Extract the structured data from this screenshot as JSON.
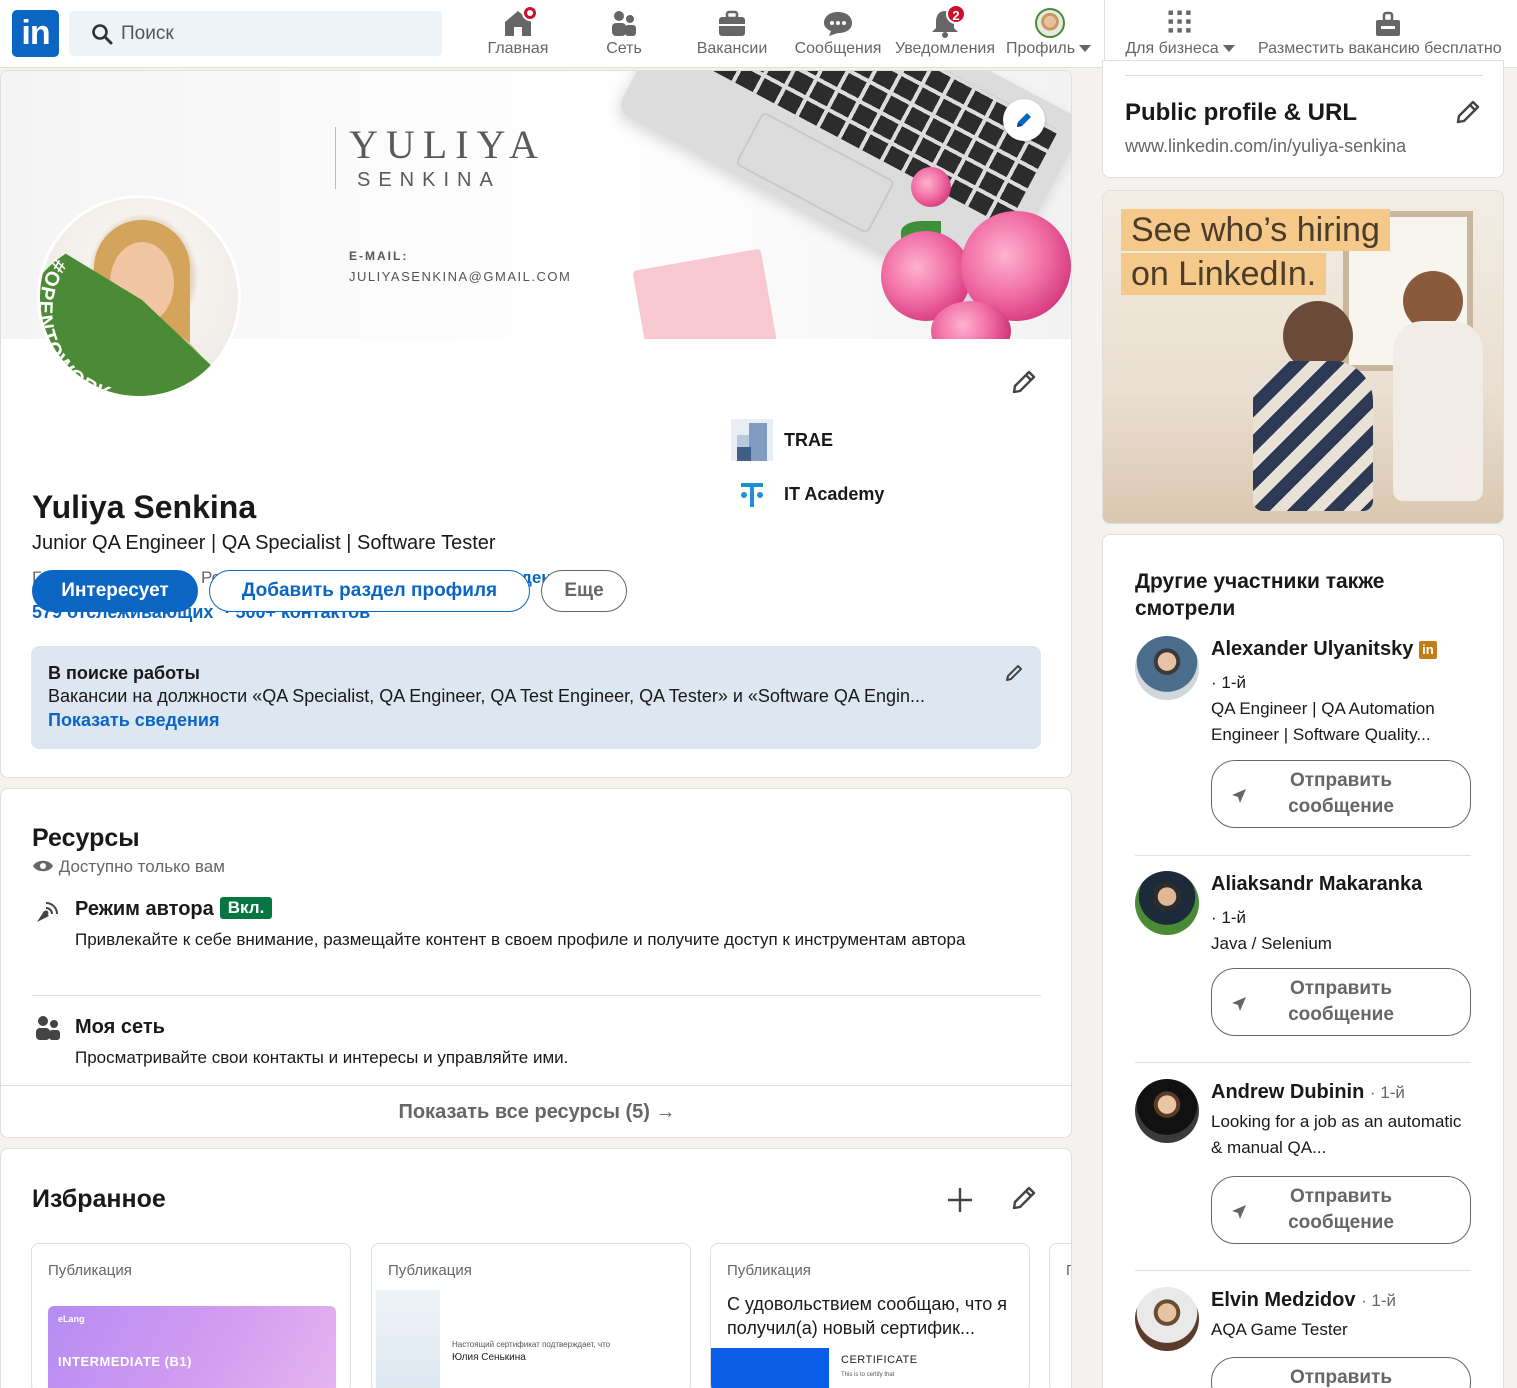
{
  "nav": {
    "search_placeholder": "Поиск",
    "items": [
      {
        "label": "Главная",
        "icon": "home-icon"
      },
      {
        "label": "Сеть",
        "icon": "network-icon"
      },
      {
        "label": "Вакансии",
        "icon": "briefcase-icon"
      },
      {
        "label": "Сообщения",
        "icon": "messages-icon"
      },
      {
        "label": "Уведомления",
        "icon": "bell-icon",
        "badge": "2"
      },
      {
        "label": "Профиль",
        "icon": "avatar"
      }
    ],
    "business_label": "Для бизнеса",
    "post_job_label": "Разместить вакансию бесплатно"
  },
  "banner": {
    "name_line1": "YULIYA",
    "name_line2": "SENKINA",
    "email_label": "E-MAIL:",
    "email_value": "JULIYASENKINA@GMAIL.COM"
  },
  "profile": {
    "open_to_work_ring": "#OPENTOWORK",
    "name": "Yuliya Senkina",
    "headline": "Junior QA Engineer | QA Specialist | Software Tester",
    "location": "Гомельская область, Республика Беларусь",
    "separator": "·",
    "contact_link": "Контактные сведения",
    "followers": "579 отслеживающих",
    "connections": "500+ контактов",
    "buttons": {
      "primary": "Интересует",
      "add_section": "Добавить раздел профиля",
      "more": "Еще"
    },
    "experience": [
      {
        "label": "TRAE"
      },
      {
        "label": "IT Academy"
      }
    ],
    "open_to_work": {
      "title": "В поиске работы",
      "text": "Вакансии на должности «QA Specialist, QA Engineer, QA Test Engineer, QA Tester» и «Software QA Engin...",
      "link": "Показать сведения"
    }
  },
  "resources": {
    "title": "Ресурсы",
    "visibility": "Доступно только вам",
    "items": [
      {
        "title": "Режим автора",
        "chip": "Вкл.",
        "desc": "Привлекайте к себе внимание, размещайте контент в своем профиле и получите доступ к инструментам автора"
      },
      {
        "title": "Моя сеть",
        "desc": "Просматривайте свои контакты и интересы и управляйте ими."
      }
    ],
    "show_all": "Показать все ресурсы (5)",
    "arrow": "→"
  },
  "featured": {
    "title": "Избранное",
    "cards": [
      {
        "kind": "Публикация",
        "image_text": "INTERMEDIATE (B1)",
        "brand": "eLang"
      },
      {
        "kind": "Публикация",
        "doc_line1": "Настоящий сертификат подтверждает, что",
        "doc_line2": "Юлия Сенькина"
      },
      {
        "kind": "Публикация",
        "text": "С удовольствием сообщаю, что я получил(а) новый сертифик...",
        "cert": "CERTIFICATE",
        "cert_sub": "This is to certify that"
      },
      {
        "kind": "П"
      }
    ]
  },
  "right": {
    "public_profile_title": "Public profile & URL",
    "public_profile_url": "www.linkedin.com/in/yuliya-senkina",
    "ad_line1": "See who’s hiring",
    "ad_line2": "on LinkedIn.",
    "others_title": "Другие участники также смотрели",
    "people": [
      {
        "name": "Alexander Ulyanitsky",
        "degree": "· 1-й",
        "headline": "QA Engineer | QA Automation Engineer | Software Quality...",
        "premium": true
      },
      {
        "name": "Aliaksandr Makaranka",
        "degree": "· 1-й",
        "headline": "Java / Selenium"
      },
      {
        "name": "Andrew Dubinin",
        "degree": "· 1-й",
        "headline": "Looking for a job as an automatic & manual QA..."
      },
      {
        "name": "Elvin Medzidov",
        "degree": "· 1-й",
        "headline": "AQA Game Tester"
      }
    ],
    "message_button": "Отправить сообщение",
    "message_button_partial": "Отправить"
  },
  "colors": {
    "brand": "#0a66c2",
    "open_to_work_green": "#057642",
    "badge_red": "#cb112d"
  }
}
